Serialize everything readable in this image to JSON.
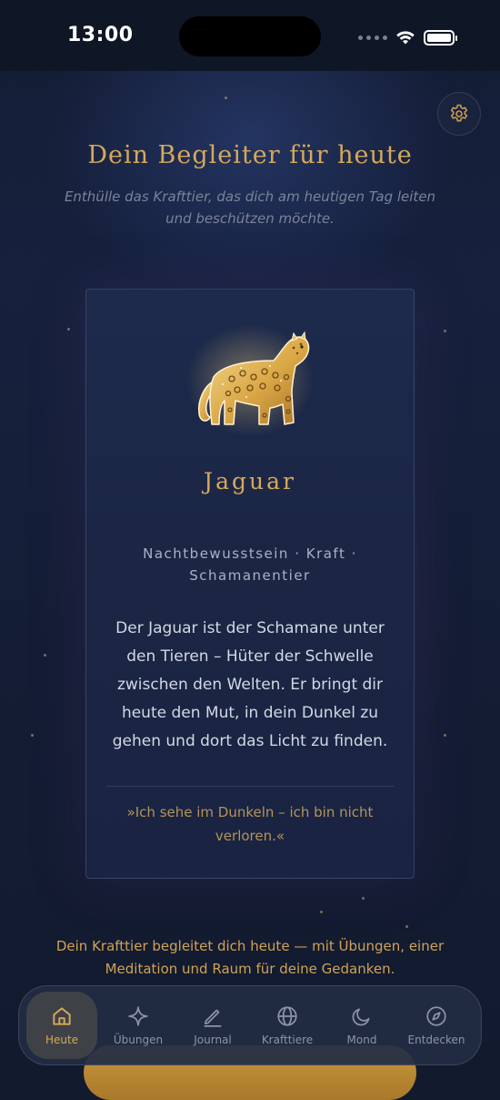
{
  "status": {
    "time": "13:00"
  },
  "header": {
    "title": "Dein Begleiter für heute",
    "subtitle": "Enthülle das Krafttier, das dich am heutigen Tag leiten und beschützen möchte."
  },
  "card": {
    "name": "Jaguar",
    "traits": "Nachtbewusstsein · Kraft · Schamanentier",
    "description": "Der Jaguar ist der Schamane unter den Tieren – Hüter der Schwelle zwischen den Welten. Er bringt dir heute den Mut, in dein Dunkel zu gehen und dort das Licht zu finden.",
    "quote": "»Ich sehe im Dunkeln – ich bin nicht verloren.«"
  },
  "footer": {
    "text": "Dein Krafttier begleitet dich heute — mit Übungen, einer Meditation und Raum für deine Gedanken."
  },
  "tabs": [
    {
      "label": "Heute",
      "icon": "home-icon"
    },
    {
      "label": "Übungen",
      "icon": "sparkle-icon"
    },
    {
      "label": "Journal",
      "icon": "pencil-icon"
    },
    {
      "label": "Krafttiere",
      "icon": "globe-icon"
    },
    {
      "label": "Mond",
      "icon": "moon-icon"
    },
    {
      "label": "Entdecken",
      "icon": "compass-icon"
    }
  ],
  "colors": {
    "accent": "#d6a85a",
    "background": "#121a2e",
    "card": "#1c2848"
  }
}
